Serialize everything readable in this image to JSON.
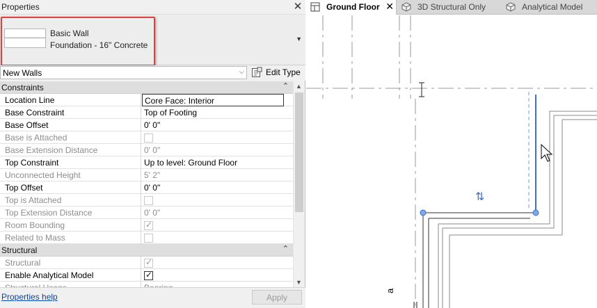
{
  "properties": {
    "title": "Properties",
    "close_glyph": "✕",
    "type_selector": {
      "family": "Basic Wall",
      "type_name": "Foundation - 16\" Concrete"
    },
    "instance_filter": "New Walls",
    "edit_type_label": "Edit Type",
    "sections": [
      {
        "name": "Constraints",
        "rows": [
          {
            "label": "Location Line",
            "value": "Core Face: Interior"
          },
          {
            "label": "Base Constraint",
            "value": "Top of Footing"
          },
          {
            "label": "Base Offset",
            "value": "0'  0\""
          },
          {
            "label": "Base is Attached",
            "checked": false
          },
          {
            "label": "Base Extension Distance",
            "value": "0'  0\""
          },
          {
            "label": "Top Constraint",
            "value": "Up to level: Ground Floor"
          },
          {
            "label": "Unconnected Height",
            "value": "5'  2\""
          },
          {
            "label": "Top Offset",
            "value": "0'  0\""
          },
          {
            "label": "Top is Attached",
            "checked": false
          },
          {
            "label": "Top Extension Distance",
            "value": "0'  0\""
          },
          {
            "label": "Room Bounding",
            "checked": true
          },
          {
            "label": "Related to Mass",
            "checked": false
          }
        ]
      },
      {
        "name": "Structural",
        "rows": [
          {
            "label": "Structural",
            "checked": true
          },
          {
            "label": "Enable Analytical Model",
            "checked": true
          },
          {
            "label": "Structural Usage",
            "value": "Bearing"
          }
        ]
      }
    ],
    "help_link": "Properties help",
    "apply_label": "Apply"
  },
  "view_tabs": [
    {
      "label": "Ground Floor",
      "active": true,
      "icon": "floor-plan-icon"
    },
    {
      "label": "3D Structural Only",
      "active": false,
      "icon": "3d-view-icon"
    },
    {
      "label": "Analytical Model",
      "active": false,
      "icon": "3d-view-icon"
    }
  ],
  "canvas": {
    "grid_bubble_label": "a",
    "flip_control_glyph": "⇅"
  },
  "colors": {
    "highlight_border": "#e0403e",
    "selected_wall": "#3a6fd1",
    "link": "#0645ad"
  }
}
